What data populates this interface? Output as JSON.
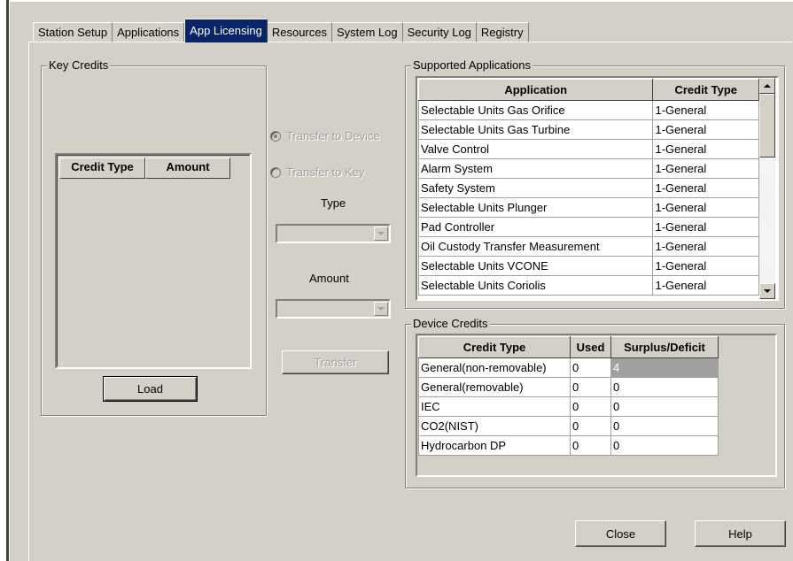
{
  "tabs": [
    {
      "label": "Station Setup"
    },
    {
      "label": "Applications"
    },
    {
      "label": "App Licensing",
      "active": true
    },
    {
      "label": "Resources"
    },
    {
      "label": "System Log"
    },
    {
      "label": "Security Log"
    },
    {
      "label": "Registry"
    }
  ],
  "key_credits": {
    "group_label": "Key Credits",
    "columns": [
      "Credit Type",
      "Amount"
    ],
    "load_label": "Load"
  },
  "transfer": {
    "to_device_label": "Transfer to Device",
    "to_key_label": "Transfer to Key",
    "type_label": "Type",
    "amount_label": "Amount",
    "transfer_label": "Transfer"
  },
  "supported_apps": {
    "group_label": "Supported Applications",
    "columns": [
      "Application",
      "Credit Type"
    ],
    "rows": [
      {
        "app": "Selectable Units Gas Orifice",
        "credit": "1-General"
      },
      {
        "app": "Selectable Units Gas Turbine",
        "credit": "1-General"
      },
      {
        "app": "Valve Control",
        "credit": "1-General"
      },
      {
        "app": "Alarm System",
        "credit": "1-General"
      },
      {
        "app": "Safety System",
        "credit": "1-General"
      },
      {
        "app": "Selectable Units Plunger",
        "credit": "1-General"
      },
      {
        "app": "Pad Controller",
        "credit": "1-General"
      },
      {
        "app": "Oil Custody Transfer Measurement",
        "credit": "1-General"
      },
      {
        "app": "Selectable Units VCONE",
        "credit": "1-General"
      },
      {
        "app": "Selectable Units Coriolis",
        "credit": "1-General"
      }
    ]
  },
  "device_credits": {
    "group_label": "Device Credits",
    "columns": [
      "Credit Type",
      "Used",
      "Surplus/Deficit"
    ],
    "rows": [
      {
        "type": "General(non-removable)",
        "used": "0",
        "surplus": "4"
      },
      {
        "type": "General(removable)",
        "used": "0",
        "surplus": "0"
      },
      {
        "type": "IEC",
        "used": "0",
        "surplus": "0"
      },
      {
        "type": "CO2(NIST)",
        "used": "0",
        "surplus": "0"
      },
      {
        "type": "Hydrocarbon DP",
        "used": "0",
        "surplus": "0"
      }
    ]
  },
  "buttons": {
    "close_label": "Close",
    "help_label": "Help"
  }
}
